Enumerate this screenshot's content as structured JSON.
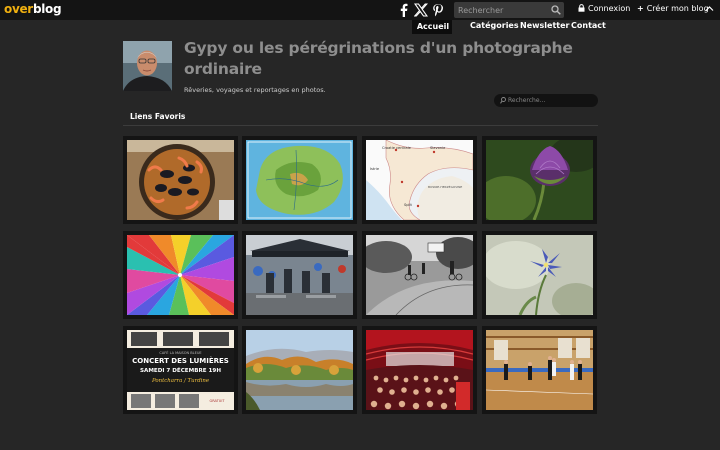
{
  "topbar": {
    "logo_part1": "over",
    "logo_part2": "blog",
    "search_placeholder": "Rechercher",
    "connexion_label": "Connexion",
    "creer_label": "Créer mon blog"
  },
  "nav": {
    "items": [
      {
        "label": "Accueil"
      },
      {
        "label": "Catégories"
      },
      {
        "label": "Newsletter"
      },
      {
        "label": "Contact"
      }
    ]
  },
  "header": {
    "title": "Gypy ou les pérégrinations d'un photographe ordinaire",
    "tagline": "Rêveries, voyages et reportages en photos.",
    "search_placeholder": "Recherche..."
  },
  "section": {
    "heading": "Liens Favoris"
  },
  "map_labels": {
    "l1": "Croatie centrale",
    "l2": "Slavonie",
    "l3": "BOSNIE-HERZÉGOVINE",
    "l4": "Split",
    "l5": "Istrie"
  },
  "poster": {
    "line1": "CAFÉ LA MAISON BLEUE",
    "line2": "CONCERT DES LUMIÈRES",
    "line3": "SAMEDI 7 DÉCEMBRE 19H",
    "line4": "Pontcharra / Turdine",
    "badge": "GRATUIT"
  },
  "colors": {
    "brand_yellow": "#f0b010",
    "background": "#262626",
    "topbar": "#141414"
  }
}
